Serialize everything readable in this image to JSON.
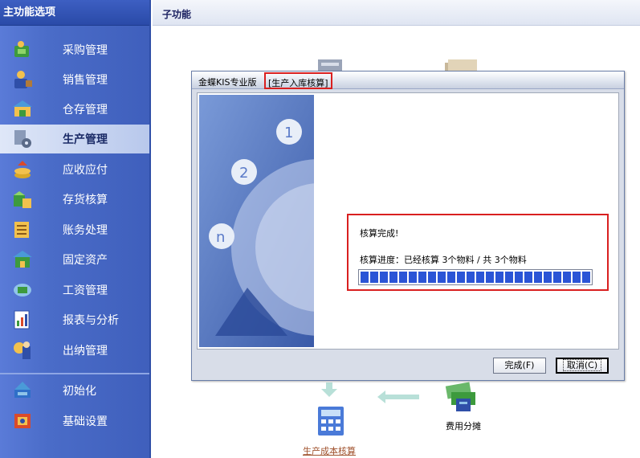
{
  "sidebar": {
    "title": "主功能选项",
    "items": [
      {
        "label": "采购管理",
        "icon": "purchase-icon"
      },
      {
        "label": "销售管理",
        "icon": "sales-icon"
      },
      {
        "label": "仓存管理",
        "icon": "warehouse-icon"
      },
      {
        "label": "生产管理",
        "icon": "production-icon",
        "active": true
      },
      {
        "label": "应收应付",
        "icon": "receivable-icon"
      },
      {
        "label": "存货核算",
        "icon": "inventory-icon"
      },
      {
        "label": "账务处理",
        "icon": "ledger-icon"
      },
      {
        "label": "固定资产",
        "icon": "fixed-asset-icon"
      },
      {
        "label": "工资管理",
        "icon": "salary-icon"
      },
      {
        "label": "报表与分析",
        "icon": "report-icon"
      },
      {
        "label": "出纳管理",
        "icon": "cashier-icon"
      },
      {
        "label": "初始化",
        "icon": "init-icon"
      },
      {
        "label": "基础设置",
        "icon": "settings-icon"
      }
    ]
  },
  "main": {
    "header_title": "子功能"
  },
  "dialog": {
    "title_prefix": "金蝶KIS专业版",
    "title_module": "[生产入库核算]",
    "status_done": "核算完成!",
    "progress_text": "核算进度：已经核算 3个物料 / 共 3个物料",
    "progress_value": 1.0,
    "finish_button": "完成(F)",
    "cancel_button": "取消(C)"
  },
  "workflow": {
    "cost_calc_label": "生产成本核算",
    "expense_alloc_label": "费用分摊"
  },
  "colors": {
    "sidebar_blue": "#4a6cc8",
    "progress_blue": "#2b55d6",
    "highlight_red": "#d92020",
    "link_brown": "#a0522d"
  }
}
